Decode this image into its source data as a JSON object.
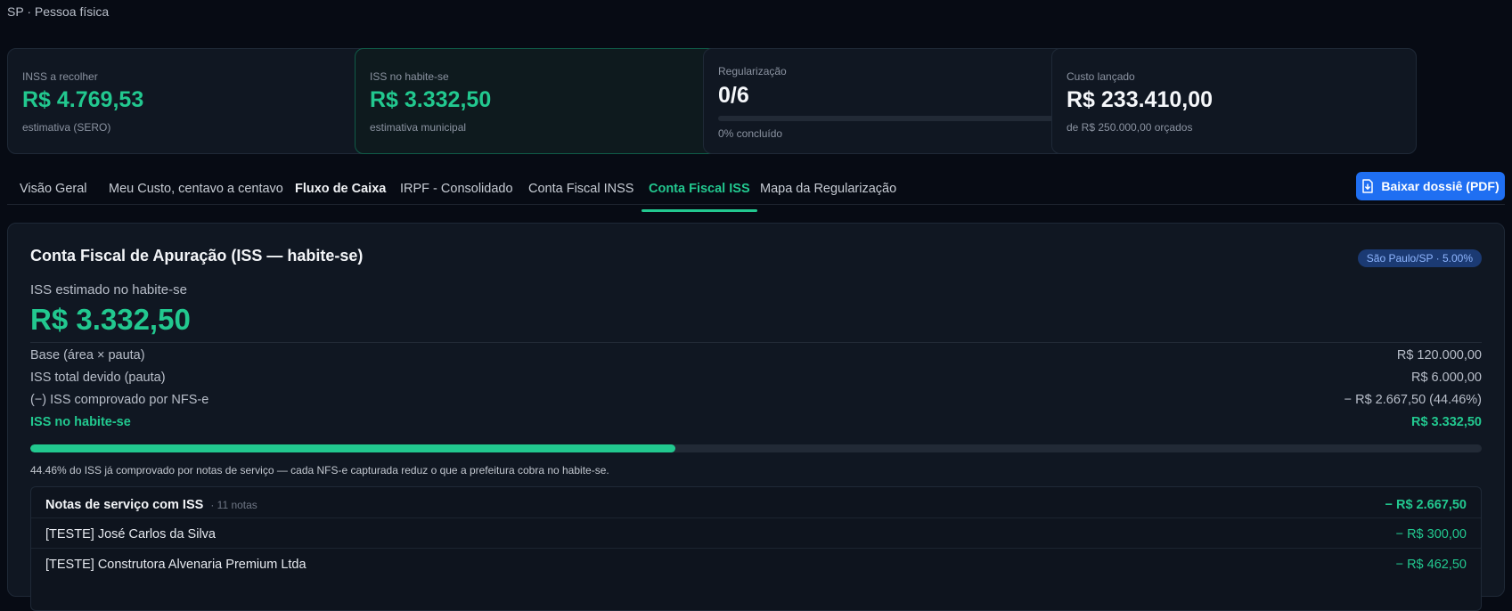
{
  "header": {
    "subtitle": "SP · Pessoa física"
  },
  "cards": [
    {
      "label": "INSS a recolher",
      "value": "R$ 4.769,53",
      "sub": "estimativa (SERO)"
    },
    {
      "label": "ISS no habite-se",
      "value": "R$ 3.332,50",
      "sub": "estimativa municipal"
    },
    {
      "label": "Regularização",
      "value": "0/6",
      "sub": "0% concluído",
      "progress": 0
    },
    {
      "label": "Custo lançado",
      "value": "R$ 233.410,00",
      "sub": "de R$ 250.000,00 orçados"
    }
  ],
  "tabs": [
    {
      "label": "Visão Geral"
    },
    {
      "label": "Meu Custo, centavo a centavo"
    },
    {
      "label": "Fluxo de Caixa"
    },
    {
      "label": "IRPF - Consolidado"
    },
    {
      "label": "Conta Fiscal INSS"
    },
    {
      "label": "Conta Fiscal ISS",
      "active": true
    },
    {
      "label": "Mapa da Regularização"
    }
  ],
  "actions": {
    "download_pdf": "Baixar dossiê (PDF)"
  },
  "panel": {
    "title": "Conta Fiscal de Apuração (ISS — habite-se)",
    "badge": "São Paulo/SP · 5.00%",
    "estimate_label": "ISS estimado no habite-se",
    "estimate_value": "R$ 3.332,50",
    "rows": [
      {
        "label": "Base (área × pauta)",
        "value": "R$ 120.000,00"
      },
      {
        "label": "ISS total devido (pauta)",
        "value": "R$ 6.000,00"
      },
      {
        "label": "(−) ISS comprovado por NFS-e",
        "value": "− R$ 2.667,50 (44.46%)"
      },
      {
        "label": "ISS no habite-se",
        "value": "R$ 3.332,50"
      }
    ],
    "progress_percent": 44.46,
    "note": "44.46% do ISS já comprovado por notas de serviço — cada NFS-e capturada reduz o que a prefeitura cobra no habite-se.",
    "notes_section": {
      "title": "Notas de serviço com ISS",
      "count": "· 11 notas",
      "total": "− R$ 2.667,50",
      "items": [
        {
          "name": "[TESTE] José Carlos da Silva",
          "amount": "− R$ 300,00"
        },
        {
          "name": "[TESTE] Construtora Alvenaria Premium Ltda",
          "amount": "− R$ 462,50"
        }
      ]
    }
  },
  "colors": {
    "accent": "#22c88f",
    "primary_button": "#1f6ff2",
    "badge_bg": "#1b3a73"
  }
}
